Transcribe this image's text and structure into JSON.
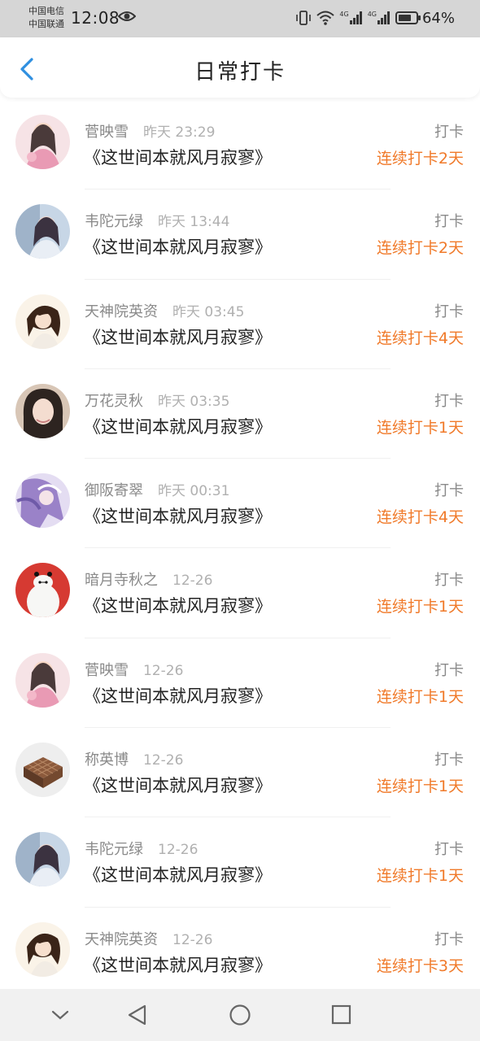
{
  "status_bar": {
    "carrier_1": "中国电信",
    "carrier_2": "中国联通",
    "time": "12:08",
    "network_1": "4G",
    "network_2": "4G",
    "battery": "64%"
  },
  "header": {
    "title": "日常打卡",
    "back_icon": "chevron-left-icon"
  },
  "colors": {
    "accent": "#f07a2a",
    "back": "#2f8fe0"
  },
  "entries": [
    {
      "name": "菅映雪",
      "time": "昨天 23:29",
      "work": "《这世间本就风月寂寥》",
      "action": "打卡",
      "streak": "连续打卡2天",
      "avatar": "anime-girl-pink"
    },
    {
      "name": "韦陀元绿",
      "time": "昨天 13:44",
      "work": "《这世间本就风月寂寥》",
      "action": "打卡",
      "streak": "连续打卡2天",
      "avatar": "photo-girl-blue"
    },
    {
      "name": "天神院英资",
      "time": "昨天 03:45",
      "work": "《这世间本就风月寂寥》",
      "action": "打卡",
      "streak": "连续打卡4天",
      "avatar": "drawn-girl-dark"
    },
    {
      "name": "万花灵秋",
      "time": "昨天 03:35",
      "work": "《这世间本就风月寂寥》",
      "action": "打卡",
      "streak": "连续打卡1天",
      "avatar": "photo-woman"
    },
    {
      "name": "御阪寄翠",
      "time": "昨天 00:31",
      "work": "《这世间本就风月寂寥》",
      "action": "打卡",
      "streak": "连续打卡4天",
      "avatar": "anime-purple"
    },
    {
      "name": "暗月寺秋之",
      "time": "12-26",
      "work": "《这世间本就风月寂寥》",
      "action": "打卡",
      "streak": "连续打卡1天",
      "avatar": "baymax-red"
    },
    {
      "name": "菅映雪",
      "time": "12-26",
      "work": "《这世间本就风月寂寥》",
      "action": "打卡",
      "streak": "连续打卡1天",
      "avatar": "anime-girl-pink"
    },
    {
      "name": "称英博",
      "time": "12-26",
      "work": "《这世间本就风月寂寥》",
      "action": "打卡",
      "streak": "连续打卡1天",
      "avatar": "waffle-box"
    },
    {
      "name": "韦陀元绿",
      "time": "12-26",
      "work": "《这世间本就风月寂寥》",
      "action": "打卡",
      "streak": "连续打卡1天",
      "avatar": "photo-girl-blue"
    },
    {
      "name": "天神院英资",
      "time": "12-26",
      "work": "《这世间本就风月寂寥》",
      "action": "打卡",
      "streak": "连续打卡3天",
      "avatar": "drawn-girl-dark"
    }
  ],
  "nav": {
    "icons": [
      "chevron-down-icon",
      "back-triangle-icon",
      "home-circle-icon",
      "recents-square-icon"
    ]
  }
}
